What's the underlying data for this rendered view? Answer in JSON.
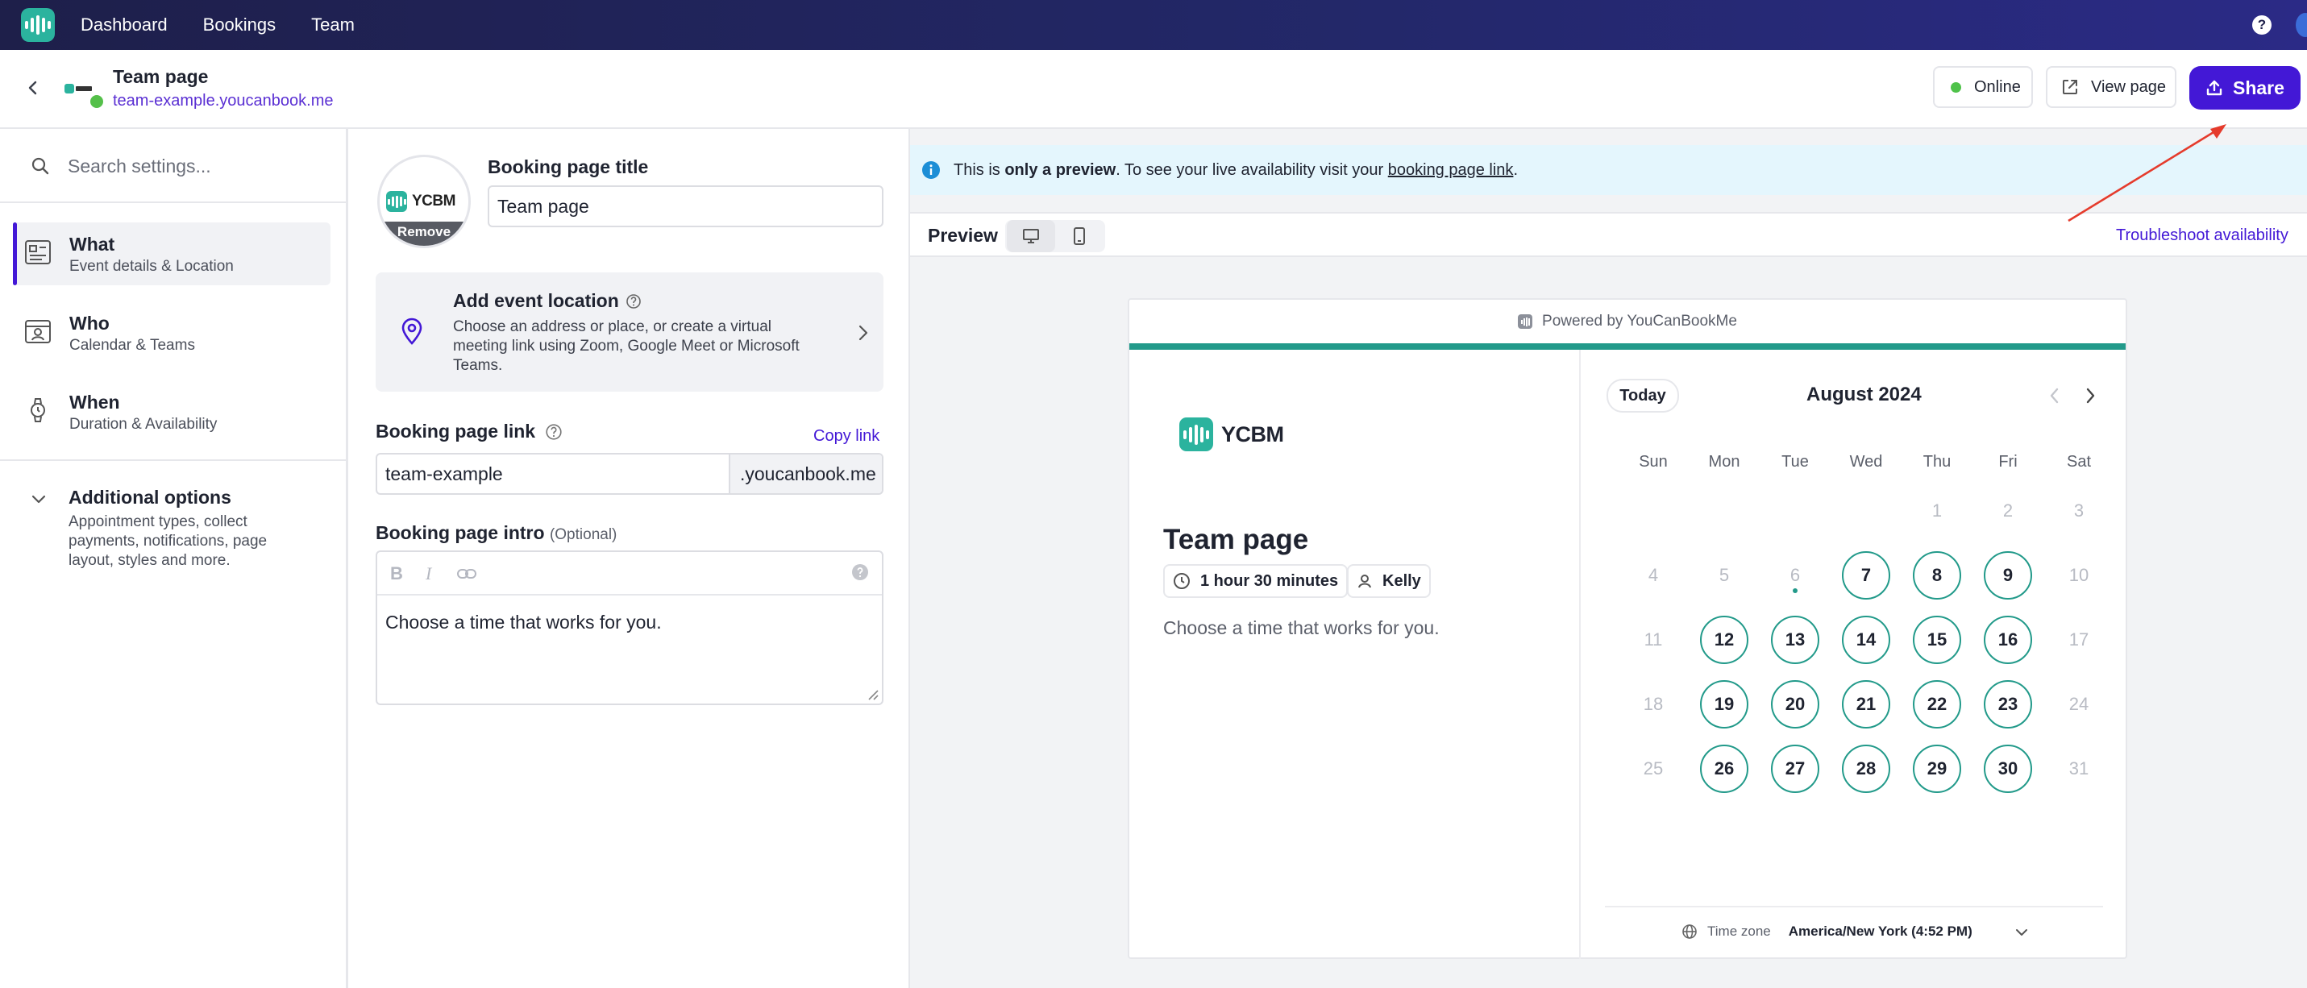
{
  "nav": {
    "items": [
      "Dashboard",
      "Bookings",
      "Team"
    ],
    "help": "?"
  },
  "header": {
    "title": "Team page",
    "url": "team-example.youcanbook.me",
    "online_label": "Online",
    "view_label": "View page",
    "share_label": "Share",
    "colors": {
      "share": "#4318d6",
      "online_dot": "#4fc24a"
    }
  },
  "sidebar": {
    "search_placeholder": "Search settings...",
    "items": [
      {
        "title": "What",
        "subtitle": "Event details & Location",
        "icon": "details-card-icon"
      },
      {
        "title": "Who",
        "subtitle": "Calendar & Teams",
        "icon": "person-calendar-icon"
      },
      {
        "title": "When",
        "subtitle": "Duration & Availability",
        "icon": "watch-icon"
      }
    ],
    "additional": {
      "title": "Additional options",
      "subtitle": "Appointment types, collect payments, notifications, page layout, styles and more."
    }
  },
  "form": {
    "avatar_logo_text": "YCBM",
    "avatar_remove": "Remove",
    "title_label": "Booking page title",
    "title_value": "Team page",
    "location": {
      "title": "Add event location",
      "description": "Choose an address or place, or create a virtual meeting link using Zoom, Google Meet or Microsoft Teams."
    },
    "link_label": "Booking page link",
    "copy_link": "Copy link",
    "link_value": "team-example",
    "link_suffix": ".youcanbook.me",
    "intro_label": "Booking page intro",
    "intro_optional": "(Optional)",
    "intro_toolbar": [
      "B",
      "I",
      "link-icon"
    ],
    "intro_value": "Choose a time that works for you."
  },
  "preview": {
    "banner": {
      "pre": "This is ",
      "bold": "only a preview",
      "mid": ". To see your live availability visit your ",
      "link": "booking page link",
      "post": "."
    },
    "label": "Preview",
    "troubleshoot": "Troubleshoot availability",
    "card": {
      "powered": "Powered by YouCanBookMe",
      "logo_text": "YCBM",
      "title": "Team page",
      "duration": "1 hour 30 minutes",
      "host": "Kelly",
      "intro": "Choose a time that works for you.",
      "accent_color": "#229a8a"
    },
    "calendar": {
      "today_label": "Today",
      "month": "August 2024",
      "weekdays": [
        "Sun",
        "Mon",
        "Tue",
        "Wed",
        "Thu",
        "Fri",
        "Sat"
      ],
      "weeks": [
        [
          "",
          "",
          "",
          "",
          "1",
          "2",
          "3"
        ],
        [
          "4",
          "5",
          "6",
          "7",
          "8",
          "9",
          "10"
        ],
        [
          "11",
          "12",
          "13",
          "14",
          "15",
          "16",
          "17"
        ],
        [
          "18",
          "19",
          "20",
          "21",
          "22",
          "23",
          "24"
        ],
        [
          "25",
          "26",
          "27",
          "28",
          "29",
          "30",
          "31"
        ]
      ],
      "available": [
        "7",
        "8",
        "9",
        "12",
        "13",
        "14",
        "15",
        "16",
        "19",
        "20",
        "21",
        "22",
        "23",
        "26",
        "27",
        "28",
        "29",
        "30"
      ],
      "today": "6",
      "timezone_label": "Time zone",
      "timezone_value": "America/New York (4:52 PM)"
    }
  }
}
